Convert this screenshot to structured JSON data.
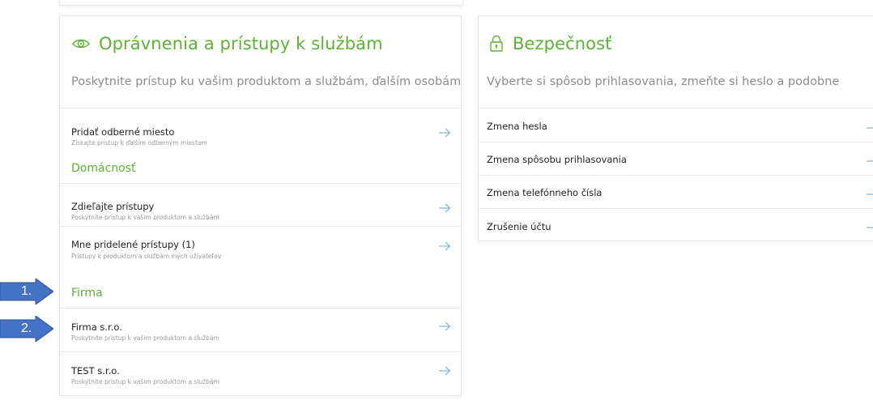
{
  "colors": {
    "accent": "#5db136",
    "arrow": "#7fb6e0",
    "marker": "#4472c4"
  },
  "left_card": {
    "icon": "eye-icon",
    "title": "Oprávnenia a prístupy k službám",
    "description": "Poskytnite prístup ku vašim produktom a službám, ďalším osobám",
    "items": [
      {
        "label": "Pridať odberné miesto",
        "sub": "Získajte prístup k ďalším odberným miestam"
      }
    ],
    "sections": [
      {
        "title": "Domácnosť",
        "items": [
          {
            "label": "Zdieľajte prístupy",
            "sub": "Poskytnite prístup k vašim produktom a službám"
          },
          {
            "label": "Mne pridelené prístupy (1)",
            "sub": "Prístupy k produktom a službám iných užívateľov"
          }
        ]
      },
      {
        "title": "Firma",
        "items": [
          {
            "label": "Firma s.r.o.",
            "sub": "Poskytnite prístup k vašim produktom a službám"
          },
          {
            "label": "TEST s.r.o.",
            "sub": "Poskytnite prístup k vašim produktom a službám"
          }
        ]
      }
    ]
  },
  "right_card": {
    "icon": "lock-icon",
    "title": "Bezpečnosť",
    "description": "Vyberte si spôsob prihlasovania, zmeňte si heslo a podobne",
    "items": [
      {
        "label": "Zmena hesla"
      },
      {
        "label": "Zmena spôsobu prihlasovania"
      },
      {
        "label": "Zmena telefónneho čísla"
      },
      {
        "label": "Zrušenie účtu"
      }
    ]
  },
  "annotations": [
    {
      "label": "1."
    },
    {
      "label": "2."
    }
  ]
}
